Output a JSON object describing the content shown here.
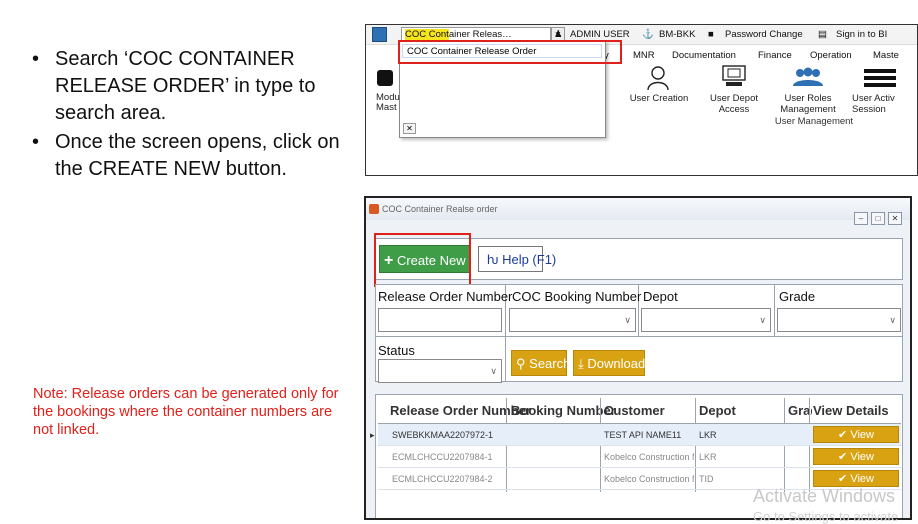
{
  "slide": {
    "bullets": [
      "Search ‘COC CONTAINER RELEASE ORDER’ in type to search area.",
      "Once the screen opens, click on the CREATE NEW button."
    ],
    "note": "Note: Release orders can be generated only for the bookings where the container numbers are not linked."
  },
  "top_screenshot": {
    "search_combo": {
      "highlight": "COC Cont",
      "rest": "ainer Releas…"
    },
    "topbar": {
      "admin_user": "ADMIN USER",
      "location": "BM-BKK",
      "password_change": "Password Change",
      "sign_in": "Sign in to BI"
    },
    "dropdown_option": "COC Container Release Order",
    "menu": [
      "y",
      "MNR",
      "Documentation",
      "Finance",
      "Operation",
      "Maste"
    ],
    "ribbon": {
      "left_partial_1": "Modu",
      "left_partial_2": "Mast",
      "user_creation": "User Creation",
      "user_depot_access": "User Depot Access",
      "user_roles_management": "User Roles Management",
      "user_active_session": "User Activ Session",
      "group_label": "User Management"
    }
  },
  "window": {
    "title": "COC Container Realse order",
    "controls": [
      "–",
      "□",
      "✕"
    ],
    "create_new": "Create New (F3)",
    "help": "Help (F1)",
    "fields": {
      "release_order_number": "Release Order Number",
      "coc_booking_number": "COC Booking Number",
      "depot": "Depot",
      "grade": "Grade",
      "status": "Status"
    },
    "search": "Search",
    "download": "Download",
    "grid": {
      "columns": [
        "Release Order Number",
        "Booking Number",
        "Customer",
        "Depot",
        "Grad",
        "View Details"
      ],
      "rows": [
        {
          "release_order": "SWEBKKMAA2207972-1",
          "booking": "",
          "customer": "TEST API NAME11",
          "depot": "LKR",
          "grade": "",
          "view": "View"
        },
        {
          "release_order": "ECMLCHCCU2207984-1",
          "booking": "",
          "customer": "Kobelco Construction Mach...",
          "depot": "LKR",
          "grade": "",
          "view": "View"
        },
        {
          "release_order": "ECMLCHCCU2207984-2",
          "booking": "",
          "customer": "Kobelco Construction Mach...",
          "depot": "TID",
          "grade": "",
          "view": "View"
        }
      ]
    }
  },
  "watermark": {
    "line1": "Activate Windows",
    "line2": "Go to Settings to activate"
  },
  "colors": {
    "note_red": "#e0201a",
    "create_green": "#3f9d48",
    "action_gold": "#d8a213",
    "highlight_yellow": "#f6e51e"
  }
}
